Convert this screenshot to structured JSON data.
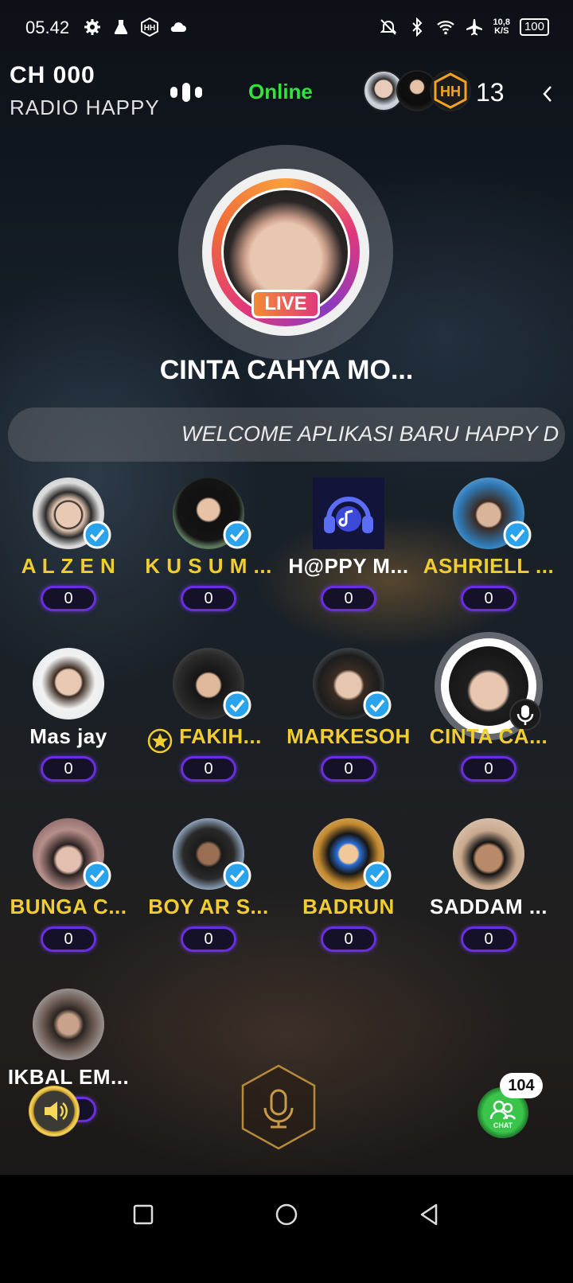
{
  "status_bar": {
    "time": "05.42",
    "net_speed_value": "10,8",
    "net_speed_unit": "K/S",
    "battery": "100",
    "icons": [
      "gear-icon",
      "flask-icon",
      "hh-app-icon",
      "cloud-icon",
      "mute-bell-icon",
      "bluetooth-icon",
      "wifi-icon",
      "airplane-icon"
    ]
  },
  "header": {
    "channel": "CH 000",
    "room_name": "RADIO HAPPY",
    "status": "Online",
    "listener_count": "13"
  },
  "host": {
    "badge": "LIVE",
    "name": "CINTA CAHYA MO..."
  },
  "marquee": {
    "text": "WELCOME APLIKASI BARU HAPPY D"
  },
  "seats": [
    {
      "name": "A L Z E N",
      "count": "0"
    },
    {
      "name": "K U S U M ...",
      "count": "0"
    },
    {
      "name": "H@PPY M...",
      "count": "0"
    },
    {
      "name": "ASHRIELL ...",
      "count": "0"
    },
    {
      "name": "Mas jay",
      "count": "0"
    },
    {
      "name": "FAKIH...",
      "count": "0"
    },
    {
      "name": "MARKESOH",
      "count": "0"
    },
    {
      "name": "CINTA CA...",
      "count": "0"
    },
    {
      "name": "BUNGA  C...",
      "count": "0"
    },
    {
      "name": "BOY AR S...",
      "count": "0"
    },
    {
      "name": "BADRUN",
      "count": "0"
    },
    {
      "name": "SADDAM ...",
      "count": "0"
    },
    {
      "name": "IKBAL EM...",
      "count": "0"
    }
  ],
  "chat": {
    "badge_count": "104",
    "label": "CHAT"
  },
  "colors": {
    "online": "#33e23f",
    "vip_name": "#f1cd32",
    "pill_border": "#6a2ee0",
    "verified": "#2aa3ee"
  }
}
